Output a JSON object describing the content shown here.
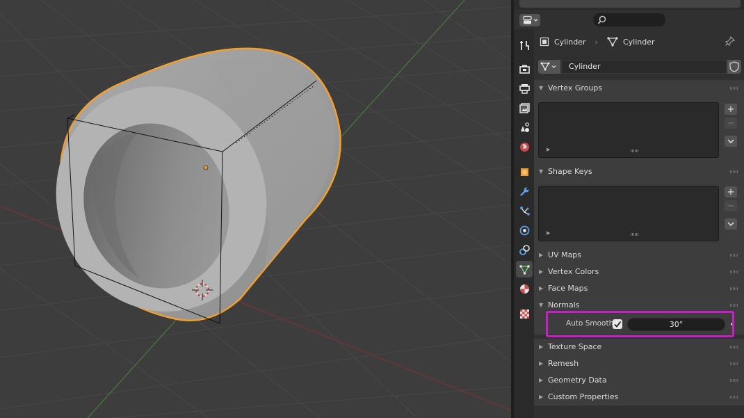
{
  "viewport": {
    "object_name": "Cylinder"
  },
  "toolbar": {
    "editor_type_icon": "editor-type-icon",
    "search_placeholder": ""
  },
  "tabs": [
    {
      "name": "tool",
      "icon": "tool-icon",
      "active": false
    },
    {
      "name": "render",
      "icon": "render-icon",
      "active": false
    },
    {
      "name": "output",
      "icon": "output-icon",
      "active": false
    },
    {
      "name": "view-layer",
      "icon": "view-layer-icon",
      "active": false
    },
    {
      "name": "scene",
      "icon": "scene-icon",
      "active": false
    },
    {
      "name": "world",
      "icon": "world-icon",
      "active": false
    },
    {
      "name": "object",
      "icon": "object-icon",
      "active": false
    },
    {
      "name": "modifiers",
      "icon": "wrench-icon",
      "active": false
    },
    {
      "name": "particles",
      "icon": "particles-icon",
      "active": false
    },
    {
      "name": "physics",
      "icon": "physics-icon",
      "active": false
    },
    {
      "name": "constraints",
      "icon": "constraints-icon",
      "active": false
    },
    {
      "name": "data",
      "icon": "mesh-data-icon",
      "active": true
    },
    {
      "name": "material",
      "icon": "material-icon",
      "active": false
    },
    {
      "name": "texture",
      "icon": "texture-icon",
      "active": false
    }
  ],
  "breadcrumb": {
    "object": "Cylinder",
    "separator": "›",
    "mesh": "Cylinder"
  },
  "datablock": {
    "name": "Cylinder"
  },
  "panels": {
    "vertex_groups": {
      "title": "Vertex Groups",
      "open": true
    },
    "shape_keys": {
      "title": "Shape Keys",
      "open": true
    },
    "uv_maps": {
      "title": "UV Maps",
      "open": false
    },
    "vertex_colors": {
      "title": "Vertex Colors",
      "open": false
    },
    "face_maps": {
      "title": "Face Maps",
      "open": false
    },
    "normals": {
      "title": "Normals",
      "open": true
    },
    "texture_space": {
      "title": "Texture Space",
      "open": false
    },
    "remesh": {
      "title": "Remesh",
      "open": false
    },
    "geometry_data": {
      "title": "Geometry Data",
      "open": false
    },
    "custom_properties": {
      "title": "Custom Properties",
      "open": false
    }
  },
  "list_buttons": {
    "add": "+",
    "remove": "−"
  },
  "normals": {
    "auto_smooth_label": "Auto Smooth",
    "auto_smooth_enabled": true,
    "angle": "30°"
  },
  "colors": {
    "selection_outline": "#f0a030",
    "highlight_box": "#c81ec8",
    "x_axis": "#8a3a3a",
    "y_axis": "#5a8a3a"
  }
}
